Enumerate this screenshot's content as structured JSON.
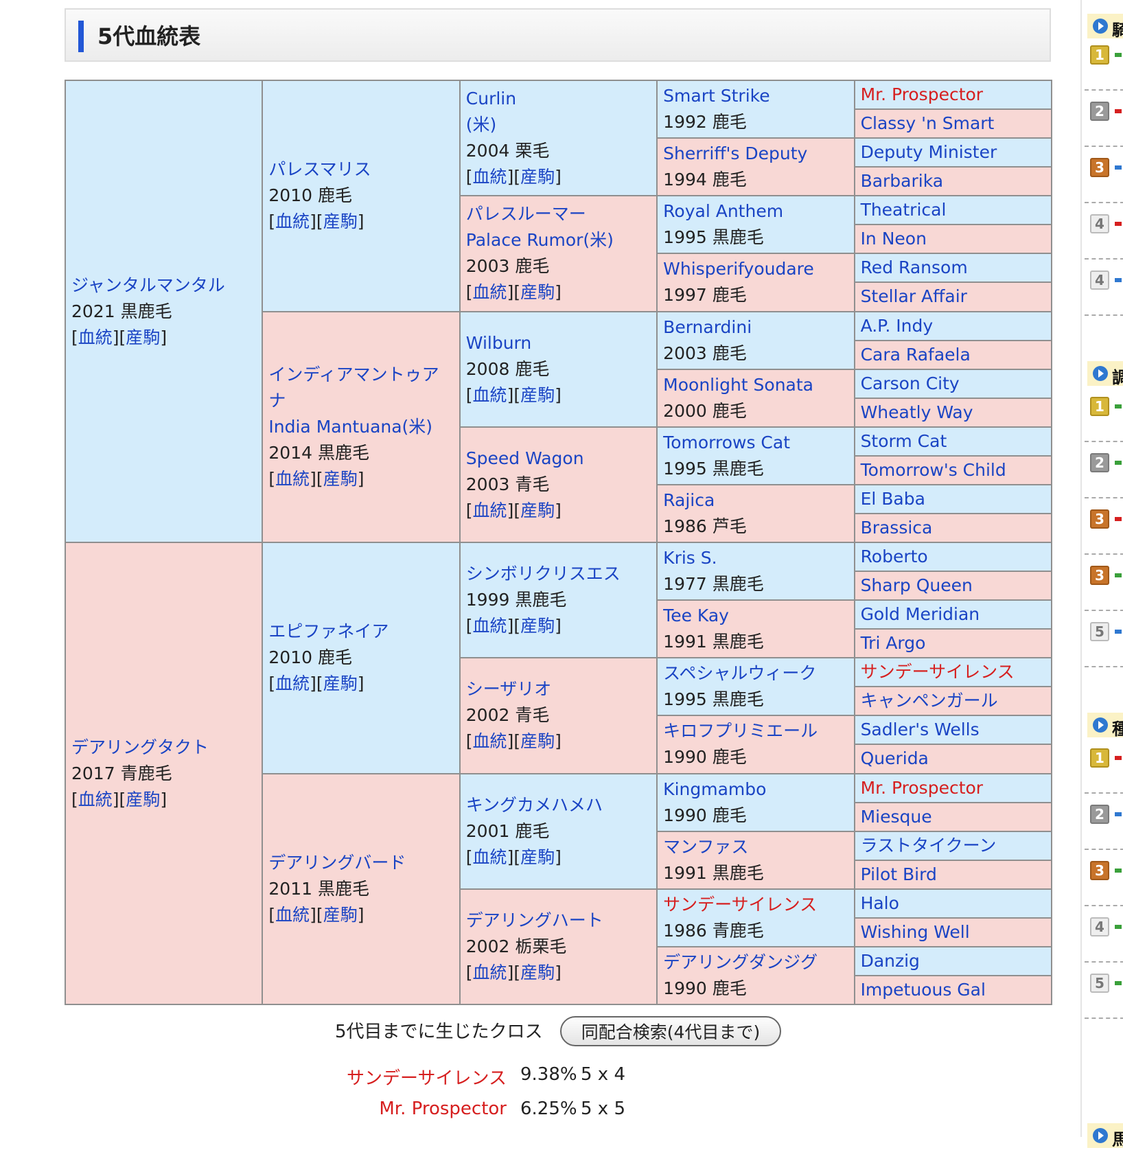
{
  "title": "5代血統表",
  "link_labels": {
    "pedigree": "血統",
    "progeny": "産駒"
  },
  "pedigree": {
    "g1": [
      {
        "name": "ジャンタルマンタル",
        "year": "2021 黒鹿毛"
      },
      {
        "name": "デアリングタクト",
        "year": "2017 青鹿毛"
      }
    ],
    "g2": [
      {
        "name": "パレスマリス",
        "year": "2010 鹿毛"
      },
      {
        "name": "インディアマントゥアナ",
        "name2": "India Mantuana(米)",
        "year": "2014 黒鹿毛"
      },
      {
        "name": "エピファネイア",
        "year": "2010 鹿毛"
      },
      {
        "name": "デアリングバード",
        "year": "2011 黒鹿毛"
      }
    ],
    "g3": [
      {
        "name": "Curlin",
        "name2": "(米)",
        "year": "2004 栗毛"
      },
      {
        "name": "パレスルーマー",
        "name2": "Palace Rumor(米)",
        "year": "2003 鹿毛"
      },
      {
        "name": "Wilburn",
        "year": "2008 鹿毛"
      },
      {
        "name": "Speed Wagon",
        "year": "2003 青毛"
      },
      {
        "name": "シンボリクリスエス",
        "year": "1999 黒鹿毛"
      },
      {
        "name": "シーザリオ",
        "year": "2002 青毛"
      },
      {
        "name": "キングカメハメハ",
        "year": "2001 鹿毛"
      },
      {
        "name": "デアリングハート",
        "year": "2002 栃栗毛"
      }
    ],
    "g4": [
      {
        "name": "Smart Strike",
        "year": "1992 鹿毛"
      },
      {
        "name": "Sherriff's Deputy",
        "year": "1994 鹿毛"
      },
      {
        "name": "Royal Anthem",
        "year": "1995 黒鹿毛"
      },
      {
        "name": "Whisperifyoudare",
        "year": "1997 鹿毛"
      },
      {
        "name": "Bernardini",
        "year": "2003 鹿毛"
      },
      {
        "name": "Moonlight Sonata",
        "year": "2000 鹿毛"
      },
      {
        "name": "Tomorrows Cat",
        "year": "1995 黒鹿毛"
      },
      {
        "name": "Rajica",
        "year": "1986 芦毛"
      },
      {
        "name": "Kris S.",
        "year": "1977 黒鹿毛"
      },
      {
        "name": "Tee Kay",
        "year": "1991 黒鹿毛"
      },
      {
        "name": "スペシャルウィーク",
        "year": "1995 黒鹿毛"
      },
      {
        "name": "キロフプリミエール",
        "year": "1990 鹿毛"
      },
      {
        "name": "Kingmambo",
        "year": "1990 鹿毛"
      },
      {
        "name": "マンファス",
        "year": "1991 黒鹿毛"
      },
      {
        "name": "サンデーサイレンス",
        "year": "1986 青鹿毛",
        "cross": true
      },
      {
        "name": "デアリングダンジグ",
        "year": "1990 鹿毛"
      }
    ],
    "g5": [
      {
        "name": "Mr. Prospector",
        "cross": true
      },
      {
        "name": "Classy 'n Smart"
      },
      {
        "name": "Deputy Minister"
      },
      {
        "name": "Barbarika"
      },
      {
        "name": "Theatrical"
      },
      {
        "name": "In Neon"
      },
      {
        "name": "Red Ransom"
      },
      {
        "name": "Stellar Affair"
      },
      {
        "name": "A.P. Indy"
      },
      {
        "name": "Cara Rafaela"
      },
      {
        "name": "Carson City"
      },
      {
        "name": "Wheatly Way"
      },
      {
        "name": "Storm Cat"
      },
      {
        "name": "Tomorrow's Child"
      },
      {
        "name": "El Baba"
      },
      {
        "name": "Brassica"
      },
      {
        "name": "Roberto"
      },
      {
        "name": "Sharp Queen"
      },
      {
        "name": "Gold Meridian"
      },
      {
        "name": "Tri Argo"
      },
      {
        "name": "サンデーサイレンス",
        "cross": true
      },
      {
        "name": "キャンペンガール"
      },
      {
        "name": "Sadler's Wells"
      },
      {
        "name": "Querida"
      },
      {
        "name": "Mr. Prospector",
        "cross": true
      },
      {
        "name": "Miesque"
      },
      {
        "name": "ラストタイクーン"
      },
      {
        "name": "Pilot Bird"
      },
      {
        "name": "Halo"
      },
      {
        "name": "Wishing Well"
      },
      {
        "name": "Danzig"
      },
      {
        "name": "Impetuous Gal"
      }
    ]
  },
  "cross": {
    "label": "5代目までに生じたクロス",
    "search_button": "同配合検索(4代目まで)",
    "items": [
      {
        "name": "サンデーサイレンス",
        "percent": "9.38%",
        "gen": "5 x 4"
      },
      {
        "name": "Mr. Prospector",
        "percent": "6.25%",
        "gen": "5 x 5"
      }
    ]
  },
  "sidebar": {
    "sections": [
      {
        "head": "騎",
        "ranks": [
          "1",
          "2",
          "3",
          "4",
          "4"
        ]
      },
      {
        "head": "調",
        "ranks": [
          "1",
          "2",
          "3",
          "3",
          "5"
        ]
      },
      {
        "head": "種",
        "ranks": [
          "1",
          "2",
          "3",
          "4",
          "5"
        ]
      },
      {
        "head": "馬",
        "ranks": []
      }
    ],
    "colors": {
      "up": "#d61f1f",
      "down": "#2f78d0",
      "same": "#3aa03a"
    }
  }
}
